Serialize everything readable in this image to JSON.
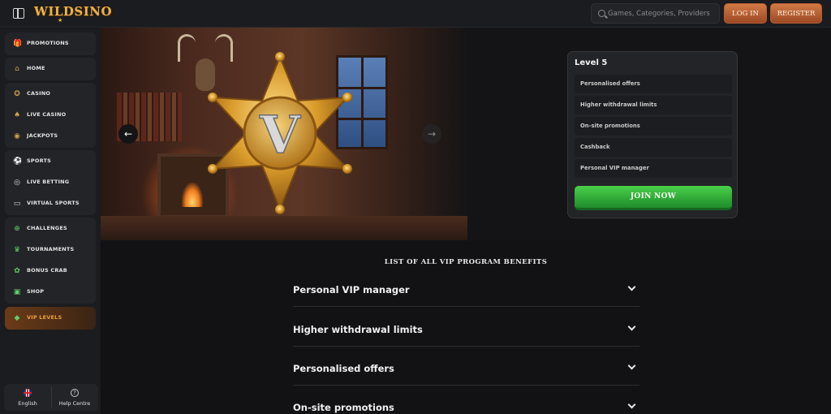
{
  "header": {
    "logo": "WILDSINO",
    "logo_star": "★",
    "search_placeholder": "Games, Categories, Providers",
    "login_label": "LOG IN",
    "register_label": "REGISTER"
  },
  "sidebar": {
    "groups": [
      {
        "items": [
          {
            "label": "PROMOTIONS",
            "icon": "gift-icon",
            "glyph": "🎁"
          }
        ]
      },
      {
        "items": [
          {
            "label": "HOME",
            "icon": "home-icon",
            "glyph": "⌂"
          }
        ]
      },
      {
        "items": [
          {
            "label": "CASINO",
            "icon": "chip-icon",
            "glyph": "✪"
          },
          {
            "label": "LIVE CASINO",
            "icon": "cards-icon",
            "glyph": "♠"
          },
          {
            "label": "JACKPOTS",
            "icon": "coin-icon",
            "glyph": "◉"
          }
        ]
      },
      {
        "items": [
          {
            "label": "SPORTS",
            "icon": "ball-icon",
            "glyph": "⚽"
          },
          {
            "label": "LIVE BETTING",
            "icon": "live-icon",
            "glyph": "◎"
          },
          {
            "label": "VIRTUAL SPORTS",
            "icon": "monitor-icon",
            "glyph": "▭"
          }
        ]
      },
      {
        "items": [
          {
            "label": "CHALLENGES",
            "icon": "target-icon",
            "glyph": "⊕"
          },
          {
            "label": "TOURNAMENTS",
            "icon": "trophy-icon",
            "glyph": "♛"
          },
          {
            "label": "BONUS CRAB",
            "icon": "crab-icon",
            "glyph": "✿"
          },
          {
            "label": "SHOP",
            "icon": "shop-icon",
            "glyph": "▣"
          }
        ]
      },
      {
        "items": [
          {
            "label": "VIP LEVELS",
            "icon": "diamond-icon",
            "glyph": "◆"
          }
        ]
      }
    ],
    "footer": {
      "language": "English",
      "help": "Help Centre",
      "help_glyph": "?"
    }
  },
  "hero": {
    "badge_letter": "V",
    "prev_glyph": "←",
    "next_glyph": "→",
    "level": {
      "title": "Level 5",
      "perks": [
        "Personalised offers",
        "Higher withdrawal limits",
        "On-site promotions",
        "Cashback",
        "Personal VIP manager"
      ],
      "cta": "JOIN NOW"
    }
  },
  "benefits": {
    "title": "LIST OF ALL VIP PROGRAM BENEFITS",
    "items": [
      "Personal VIP manager",
      "Higher withdrawal limits",
      "Personalised offers",
      "On-site promotions"
    ]
  },
  "colors": {
    "accent_orange": "#c56a3a",
    "gold": "#e9b24a",
    "join_green": "#2fae35",
    "background": "#141416"
  }
}
